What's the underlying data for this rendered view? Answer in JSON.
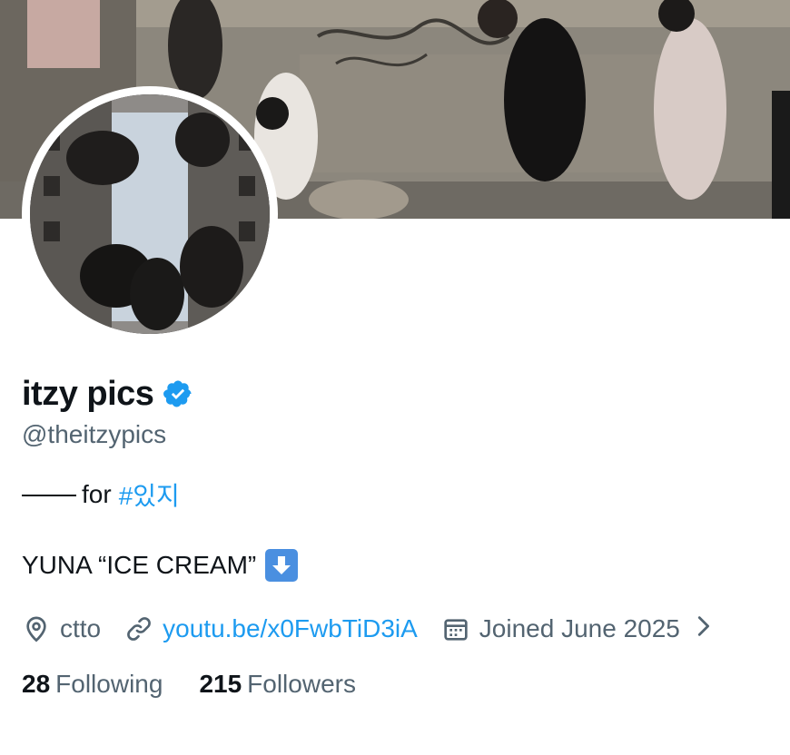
{
  "profile": {
    "display_name": "itzy pics",
    "handle": "@theitzypics",
    "bio_line1_prefix": "for",
    "bio_hashtag": "#있지",
    "bio_line2": "YUNA “ICE CREAM”",
    "location": "ctto",
    "website": "youtu.be/x0FwbTiD3iA",
    "joined": "Joined June 2025",
    "following_count": "28",
    "following_label": "Following",
    "followers_count": "215",
    "followers_label": "Followers"
  },
  "icons": {
    "verified": "verified-badge-icon",
    "location": "location-pin-icon",
    "link": "link-icon",
    "calendar": "calendar-icon",
    "chevron": "chevron-right-icon",
    "emoji": "down-arrow-emoji-icon"
  },
  "colors": {
    "accent": "#1d9bf0",
    "text": "#0f1419",
    "muted": "#536471"
  }
}
